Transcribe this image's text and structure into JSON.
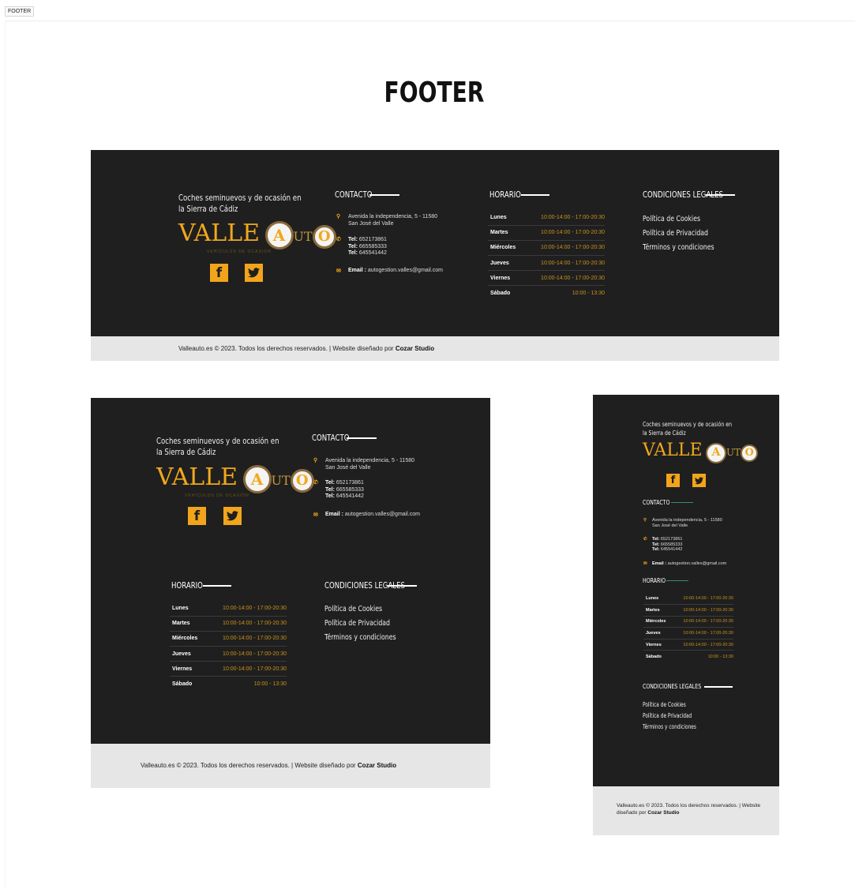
{
  "tab": {
    "label": "FOOTER"
  },
  "page_title": "FOOTER",
  "footer": {
    "tagline": "Coches seminuevos y de ocasión en la Sierra de Cádiz",
    "logo": {
      "word": "VALLE",
      "o1": "A",
      "o2": "UTO",
      "o3": "O",
      "sub": "VEHÍCULOS DE OCASIÓN"
    },
    "social": {
      "facebook": "f",
      "twitter": "t"
    },
    "contact": {
      "heading": "CONTACTO",
      "address_line1": "Avenida la independencia, 5 - 11580",
      "address_line2": "San José del Valle",
      "tel_label": "Tel:",
      "tel1": "652173861",
      "tel2": "665585333",
      "tel3": "645541442",
      "email_label": "Email :",
      "email": "autogestion.valles@gmail.com"
    },
    "schedule": {
      "heading": "HORARIO",
      "rows": [
        {
          "day": "Lunes",
          "hours": "10:00-14:00 - 17:00-20:30"
        },
        {
          "day": "Martes",
          "hours": "10:00-14:00 - 17:00-20:30"
        },
        {
          "day": "Miércoles",
          "hours": "10:00-14:00 - 17:00-20:30"
        },
        {
          "day": "Jueves",
          "hours": "10:00-14:00 - 17:00-20:30"
        },
        {
          "day": "Viernes",
          "hours": "10:00-14:00 - 17:00-20:30"
        },
        {
          "day": "Sábado",
          "hours": "10:00 - 13:30"
        }
      ]
    },
    "legal": {
      "heading": "CONDICIONES LEGALES",
      "links": [
        "Política de Cookies",
        "Política de Privacidad",
        "Términos y condiciones"
      ]
    },
    "credit": {
      "text": "Valleauto.es © 2023. Todos los derechos reservados. | Website diseñado por ",
      "studio": "Cozar Studio"
    }
  },
  "colors": {
    "footer_bg": "#1f1f1f",
    "bottom_bar_bg": "#e6e6e6",
    "accent": "#f2a51a",
    "hours_text": "#c8921c"
  },
  "icons": [
    "map-pin-icon",
    "phone-icon",
    "envelope-icon",
    "facebook-icon",
    "twitter-icon"
  ]
}
